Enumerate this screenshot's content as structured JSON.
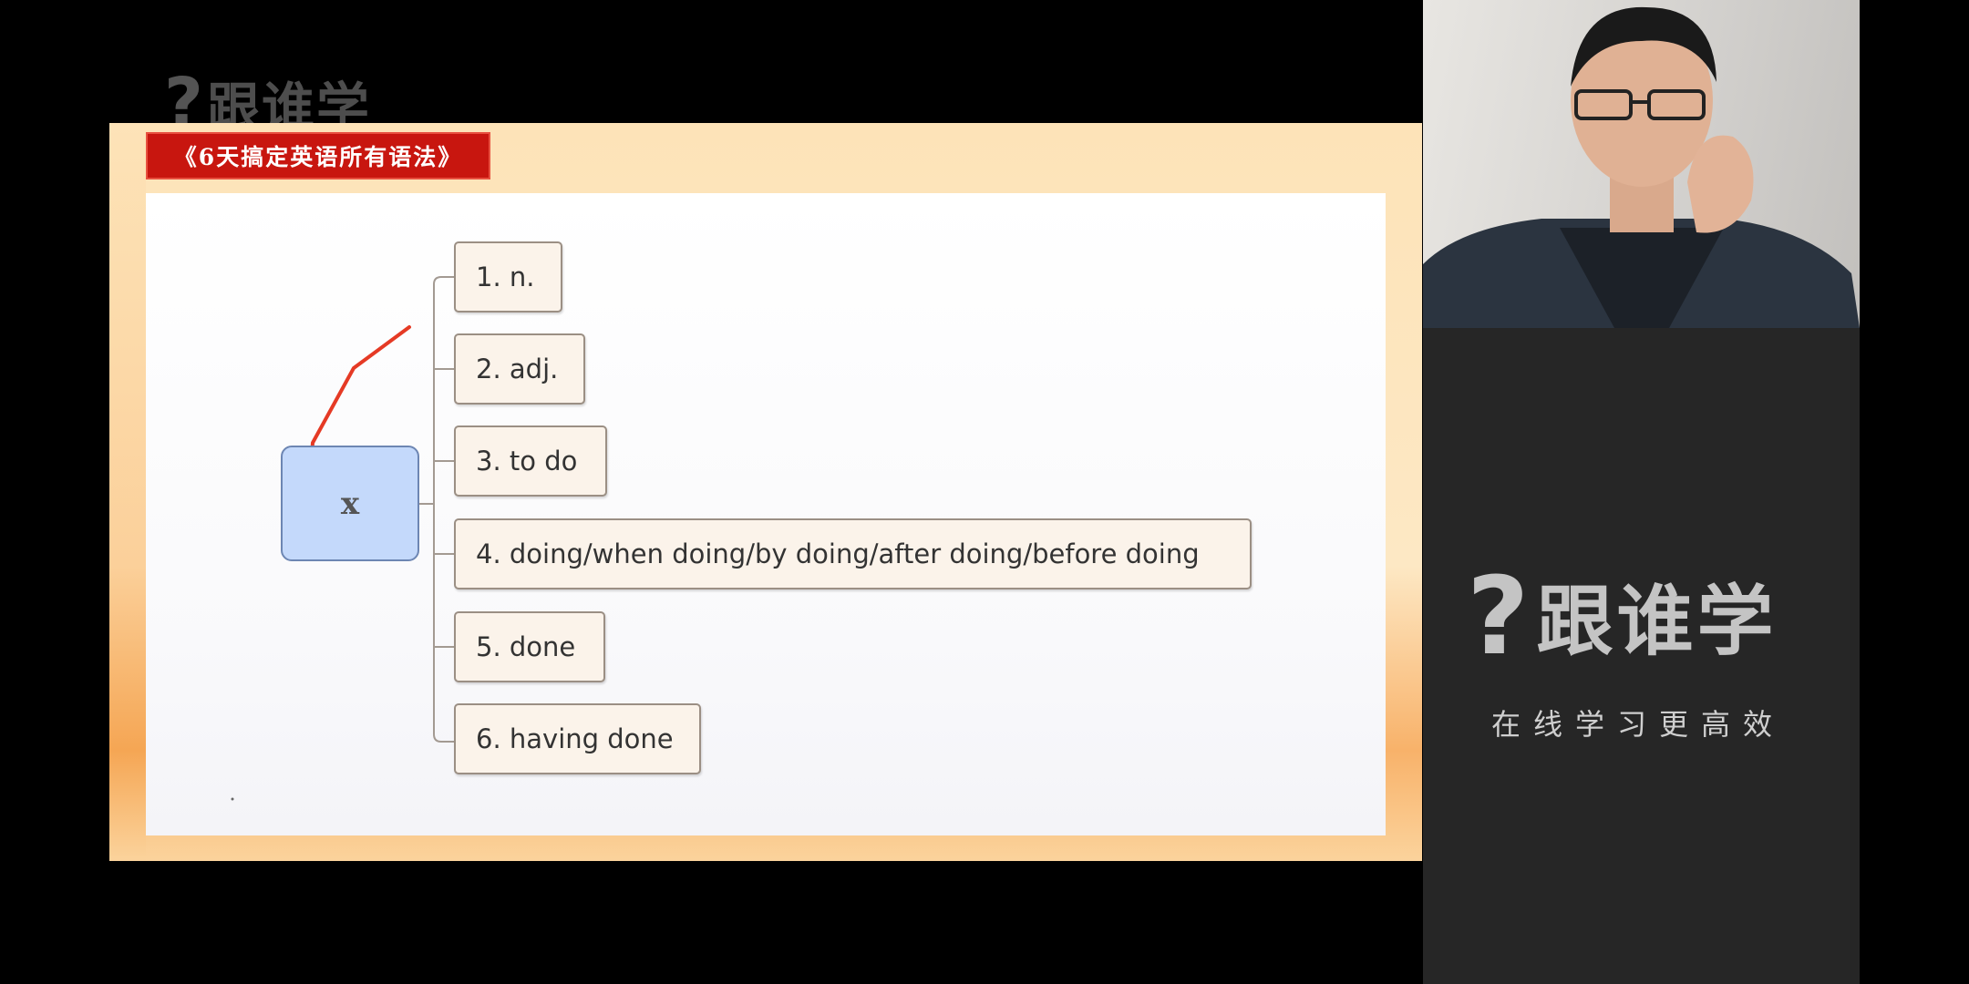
{
  "watermark": {
    "brand": "跟谁学"
  },
  "slide": {
    "title": "《6天搞定英语所有语法》",
    "root_label": "x",
    "nodes": [
      "1. n.",
      "2. adj.",
      "3. to do",
      "4. doing/when doing/by doing/after doing/before doing",
      "5. done",
      "6. having done"
    ],
    "colors": {
      "banner": "#c8160f",
      "annotation": "#e53a25",
      "root_fill": "#c4d9fb"
    }
  },
  "panel": {
    "brand": "跟谁学",
    "slogan": "在线学习更高效"
  }
}
